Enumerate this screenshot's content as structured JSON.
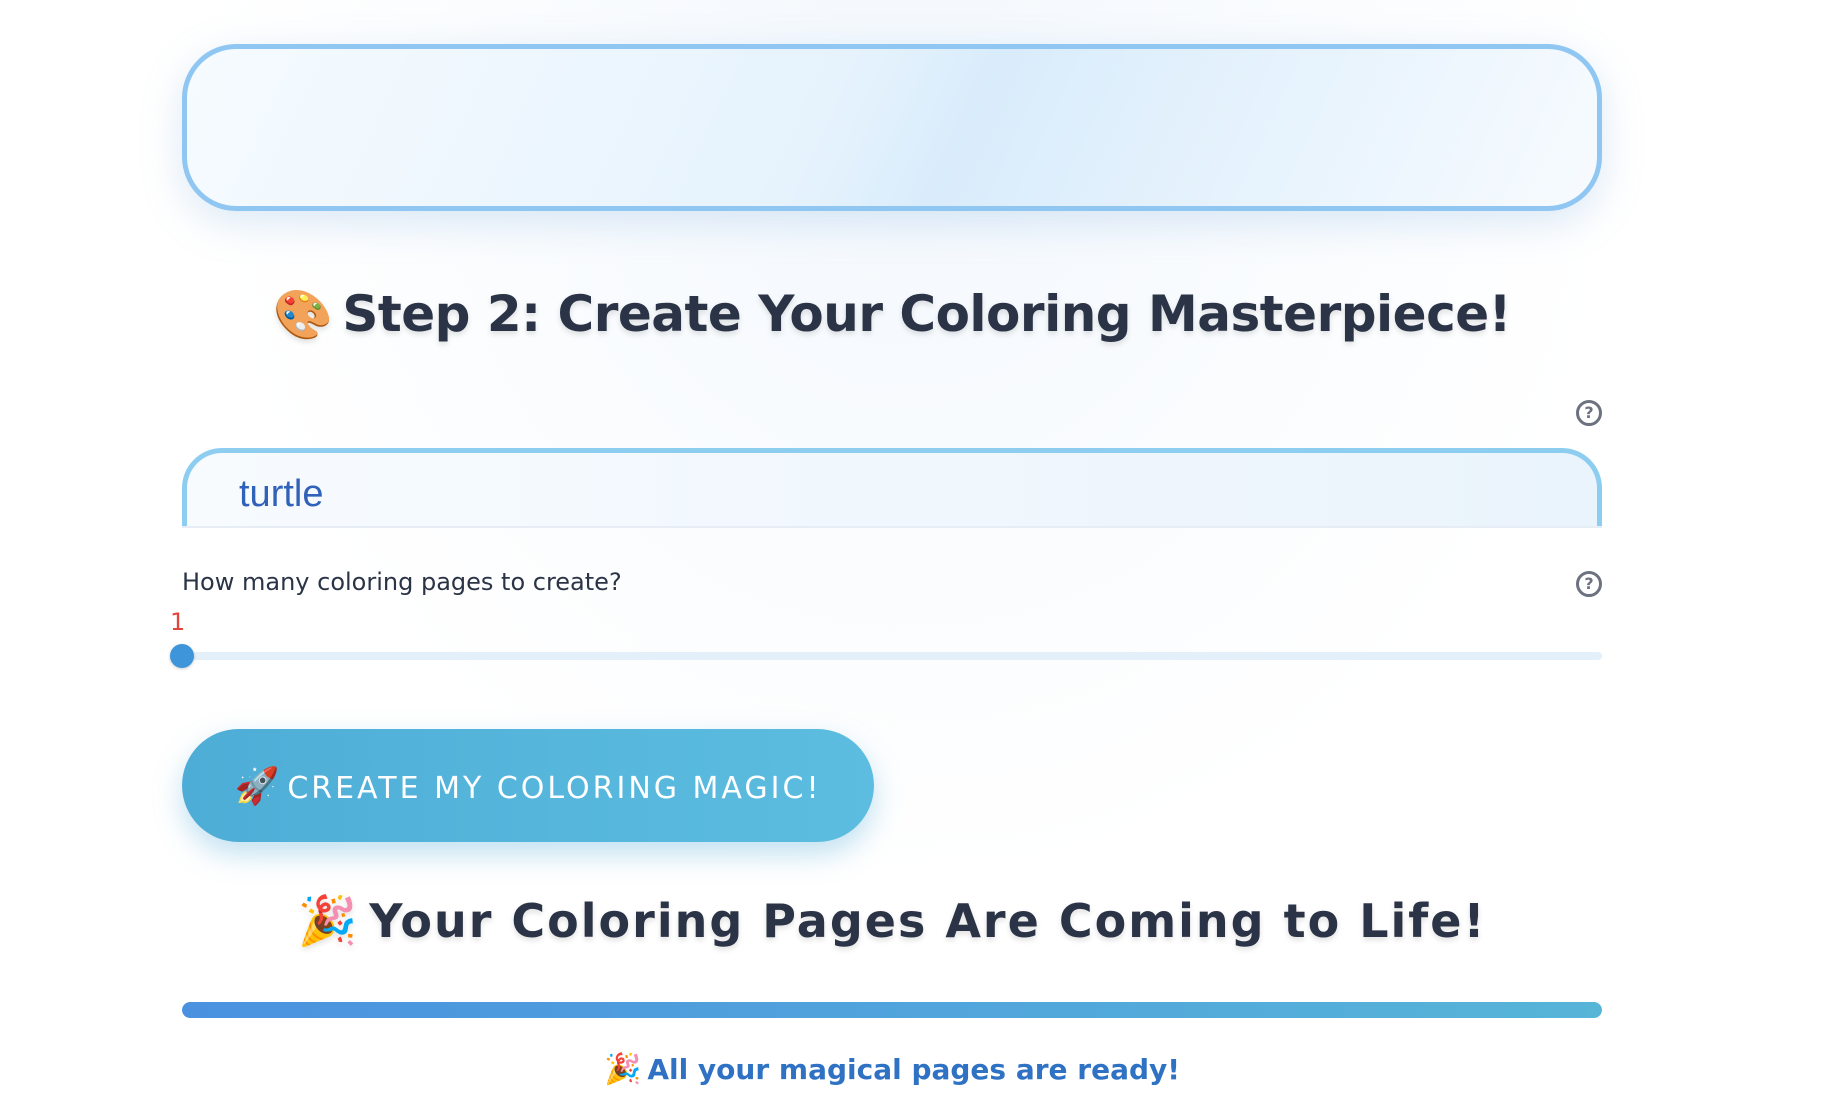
{
  "step2": {
    "title_emoji": "🎨",
    "title": "Step 2: Create Your Coloring Masterpiece!"
  },
  "help_icon_glyph": "?",
  "prompt_input": {
    "value": "turtle",
    "help_icon": "question-circle-icon"
  },
  "slider": {
    "label": "How many coloring pages to create?",
    "value": "1",
    "fraction": 0,
    "help_icon": "question-circle-icon",
    "accent_color": "#3e95d9",
    "value_color": "#e0463c"
  },
  "cta": {
    "emoji": "🚀",
    "label": "CREATE MY COLORING MAGIC!",
    "color": "#4eadd6"
  },
  "result": {
    "title_emoji": "🎉",
    "title": "Your Coloring Pages Are Coming to Life!",
    "progress": 1.0,
    "ready_emoji": "🎉",
    "ready_text": "All your magical pages are ready!",
    "ready_color": "#2f72c4"
  }
}
